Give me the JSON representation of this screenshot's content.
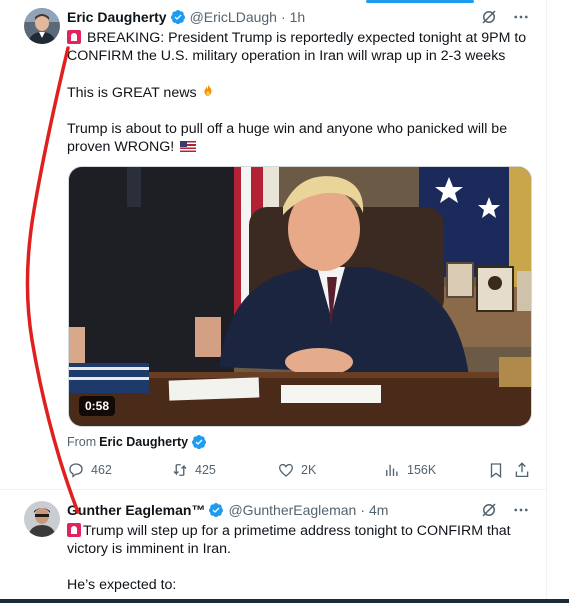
{
  "tweets": [
    {
      "author": "Eric Daugherty",
      "handle": "@EricLDaugh",
      "time": "1h",
      "lines": [
        "BREAKING: President Trump is reportedly expected tonight at 9PM to",
        "CONFIRM the U.S. military operation in Iran will wrap up in 2-3 weeks",
        "This is GREAT news",
        "Trump is about to pull off a huge win and anyone who panicked will be",
        "proven WRONG!"
      ],
      "video_duration": "0:58",
      "from_label": "From",
      "from_name": "Eric Daugherty",
      "stats": {
        "replies": "462",
        "reposts": "425",
        "likes": "2K",
        "views": "156K"
      }
    },
    {
      "author": "Gunther Eagleman™",
      "handle": "@GuntherEagleman",
      "time": "4m",
      "lines": [
        "Trump will step up for a primetime address tonight to CONFIRM that",
        "victory is imminent in Iran.",
        "He’s expected to:"
      ]
    }
  ],
  "icons": [
    "verified-badge-icon",
    "grok-icon",
    "more-icon",
    "reply-icon",
    "repost-icon",
    "like-icon",
    "views-icon",
    "bookmark-icon",
    "share-icon",
    "siren-emoji",
    "fire-emoji",
    "us-flag-emoji"
  ],
  "colors": {
    "accent": "#1d9bf0",
    "text": "#0f1419",
    "secondary": "#536471",
    "annotation": "#e0201e"
  }
}
